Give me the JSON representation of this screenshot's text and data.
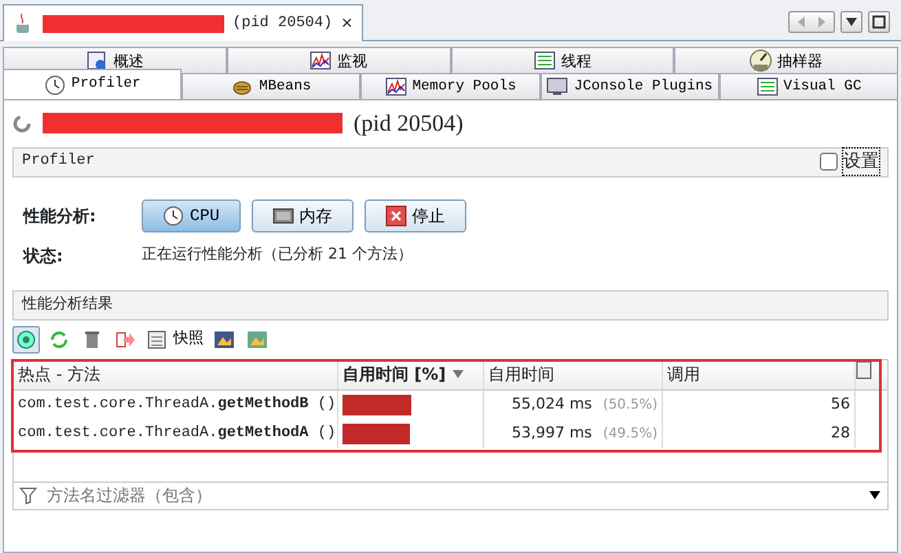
{
  "document_tab": {
    "title_redacted": true,
    "pid": "(pid 20504)",
    "close": "×"
  },
  "tab_rows": [
    [
      {
        "label": "概述",
        "selected": false
      },
      {
        "label": "监视",
        "selected": false
      },
      {
        "label": "线程",
        "selected": false
      },
      {
        "label": "抽样器",
        "selected": false
      }
    ],
    [
      {
        "label": "Profiler",
        "selected": true
      },
      {
        "label": "MBeans",
        "selected": false
      },
      {
        "label": "Memory Pools",
        "selected": false
      },
      {
        "label": "JConsole Plugins",
        "selected": false
      },
      {
        "label": "Visual GC",
        "selected": false
      }
    ]
  ],
  "heading": {
    "title_redacted": true,
    "pid": "(pid 20504)"
  },
  "profiler_panel": {
    "title": "Profiler",
    "settings": {
      "label": "设置",
      "checked": false
    }
  },
  "profile_label": "性能分析:",
  "profile_buttons": [
    {
      "label": "CPU",
      "selected": true
    },
    {
      "label": "内存",
      "selected": false
    },
    {
      "label": "停止",
      "selected": false
    }
  ],
  "status_label": "状态:",
  "status_text": "正在运行性能分析（已分析 21 个方法）",
  "results": {
    "title": "性能分析结果",
    "snapshot_label": "快照",
    "columns": [
      {
        "label": "热点 - 方法",
        "sorted": false
      },
      {
        "label": "自用时间 [%]",
        "sorted": true
      },
      {
        "label": "自用时间",
        "sorted": false
      },
      {
        "label": "调用",
        "sorted": false
      }
    ],
    "rows": [
      {
        "class": "com.test.core.ThreadA.",
        "method": "getMethodB",
        "args": "()",
        "level": 0.505,
        "time": "55,024 ms",
        "percent": "(50.5%)",
        "calls": "56"
      },
      {
        "class": "com.test.core.ThreadA.",
        "method": "getMethodA",
        "args": "()",
        "level": 0.495,
        "time": "53,997 ms",
        "percent": "(49.5%)",
        "calls": "28"
      }
    ],
    "highlighted": true,
    "filter_placeholder": "方法名过滤器（包含）"
  }
}
